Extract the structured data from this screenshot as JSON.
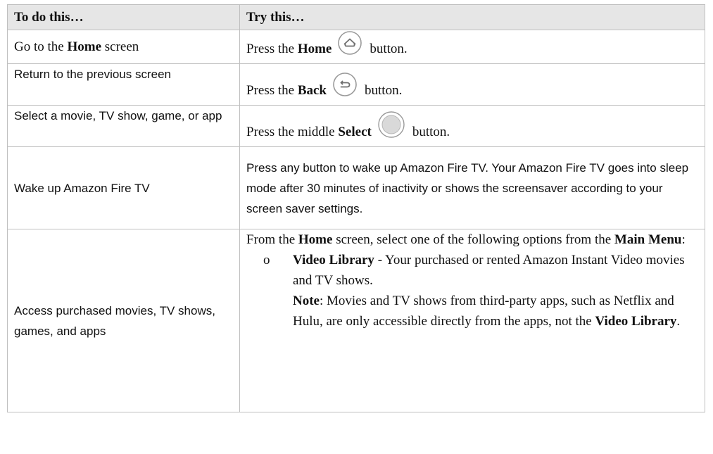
{
  "table": {
    "headers": {
      "col1": "To do this…",
      "col2": "Try this…"
    },
    "rows": {
      "home": {
        "task": "Go to the ",
        "task_bold": "Home",
        "task_suffix": " screen",
        "action_prefix": "Press the ",
        "action_bold": "Home",
        "action_suffix": "button.",
        "icon": "home-icon"
      },
      "back": {
        "task": "Return to the previous screen",
        "action_prefix": "Press the ",
        "action_bold": "Back",
        "action_suffix": "button.",
        "icon": "back-icon"
      },
      "select": {
        "task": "Select a movie, TV show, game, or app",
        "action_prefix": "Press the middle ",
        "action_bold": "Select",
        "action_suffix": "button.",
        "icon": "select-icon"
      },
      "wake": {
        "task": "Wake up Amazon Fire TV",
        "action": "Press any button to wake up Amazon Fire TV. Your Amazon Fire TV goes into sleep mode after 30 minutes of inactivity or shows the screensaver according to your screen saver settings."
      },
      "access": {
        "task": "Access purchased movies, TV shows, games, and apps",
        "intro_1": "From the ",
        "intro_bold_1": "Home",
        "intro_2": " screen, select one of the following options from the ",
        "intro_bold_2": "Main Menu",
        "intro_3": ":",
        "bullet_glyph": "o",
        "bullet_title": "Video Library",
        "bullet_text": " - Your purchased or rented Amazon Instant Video movies and TV shows.",
        "note_label": "Note",
        "note_text": ": Movies and TV shows from third-party apps, such as Netflix and Hulu, are only accessible directly from the apps, not the ",
        "note_bold": "Video Library",
        "note_end": "."
      }
    }
  }
}
